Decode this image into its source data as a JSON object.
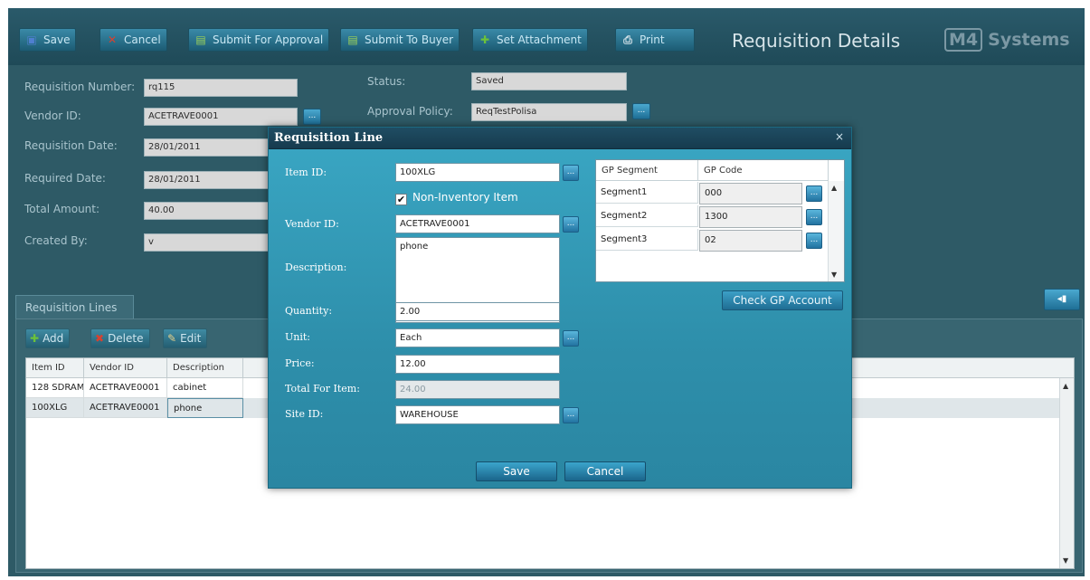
{
  "toolbar": {
    "save_label": "Save",
    "cancel_label": "Cancel",
    "submit_approval_label": "Submit For Approval",
    "submit_buyer_label": "Submit To Buyer",
    "set_attachment_label": "Set Attachment",
    "print_label": "Print",
    "page_title": "Requisition Details",
    "logo_mark": "M4",
    "logo_text": "Systems"
  },
  "header": {
    "requisition_number_label": "Requisition Number:",
    "requisition_number": "rq115",
    "vendor_id_label": "Vendor ID:",
    "vendor_id": "ACETRAVE0001",
    "requisition_date_label": "Requisition Date:",
    "requisition_date": "28/01/2011",
    "required_date_label": "Required Date:",
    "required_date": "28/01/2011",
    "total_amount_label": "Total Amount:",
    "total_amount": "40.00",
    "created_by_label": "Created By:",
    "created_by": "v",
    "status_label": "Status:",
    "status": "Saved",
    "approval_policy_label": "Approval Policy:",
    "approval_policy": "ReqTestPolisa"
  },
  "lines": {
    "tab_label": "Requisition Lines",
    "add_label": "Add",
    "delete_label": "Delete",
    "edit_label": "Edit",
    "columns": [
      "Item ID",
      "Vendor ID",
      "Description"
    ],
    "rows": [
      [
        "128 SDRAM",
        "ACETRAVE0001",
        "cabinet"
      ],
      [
        "100XLG",
        "ACETRAVE0001",
        "phone"
      ]
    ]
  },
  "modal": {
    "title": "Requisition Line",
    "close_glyph": "×",
    "item_id_label": "Item ID:",
    "item_id": "100XLG",
    "non_inventory_label": "Non-Inventory Item",
    "non_inventory_checked": true,
    "vendor_id_label": "Vendor ID:",
    "vendor_id": "ACETRAVE0001",
    "description_label": "Description:",
    "description": "phone",
    "quantity_label": "Quantity:",
    "quantity": "2.00",
    "unit_label": "Unit:",
    "unit": "Each",
    "price_label": "Price:",
    "price": "12.00",
    "total_label": "Total For Item:",
    "total": "24.00",
    "site_id_label": "Site ID:",
    "site_id": "WAREHOUSE",
    "segment_grid": {
      "col_segment": "GP Segment",
      "col_code": "GP Code",
      "rows": [
        {
          "segment": "Segment1",
          "code": "000"
        },
        {
          "segment": "Segment2",
          "code": "1300"
        },
        {
          "segment": "Segment3",
          "code": "02"
        }
      ]
    },
    "check_gp_label": "Check GP Account",
    "save_label": "Save",
    "cancel_label": "Cancel",
    "lookup_glyph": "..."
  },
  "colors": {
    "app_background": "#2e5a66",
    "toolbar_button": "#1c5b73",
    "modal_background": "#2e8fab",
    "modal_title_bar": "#163b4e"
  },
  "icons": {
    "save": "floppy-icon",
    "cancel": "x-icon",
    "submit": "document-arrow-icon",
    "attachment": "plus-icon",
    "print": "printer-icon"
  }
}
